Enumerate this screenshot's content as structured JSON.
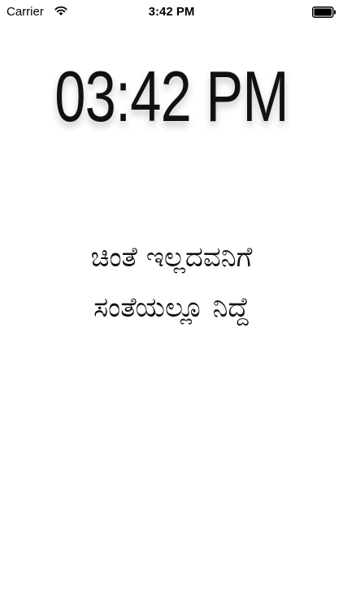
{
  "status_bar": {
    "carrier": "Carrier",
    "time": "3:42 PM",
    "icons": [
      "wifi-icon",
      "battery-icon"
    ]
  },
  "clock": {
    "display_time": "03:42 PM"
  },
  "proverb": {
    "line1": "ಚಿಂತೆ ಇಲ್ಲದವನಿಗೆ",
    "line2": "ಸಂತೆಯಲ್ಲೂ ನಿದ್ದೆ"
  }
}
